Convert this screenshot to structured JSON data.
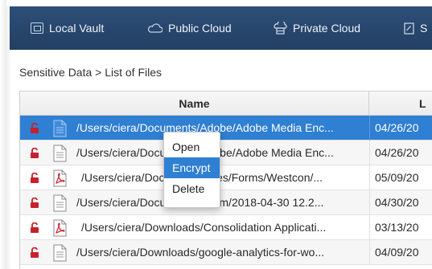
{
  "nav": {
    "items": [
      {
        "label": "Local Vault",
        "icon": "vault-icon"
      },
      {
        "label": "Public Cloud",
        "icon": "cloud-icon"
      },
      {
        "label": "Private Cloud",
        "icon": "private-cloud-icon"
      },
      {
        "label": "S",
        "icon": "document-icon"
      }
    ],
    "background_color": "#2a4a70"
  },
  "breadcrumb": "Sensitive Data > List of Files",
  "table": {
    "columns": [
      "Name",
      "L"
    ],
    "rows": [
      {
        "name": "/Users/ciera/Documents/Adobe/Adobe Media Enc...",
        "date": "04/26/20",
        "type": "document",
        "selected": true
      },
      {
        "name": "/Users/ciera/Documents/Adobe/Adobe Media Enc...",
        "date": "04/26/20",
        "type": "document",
        "selected": false
      },
      {
        "name": "/Users/ciera/Documents/Files/Forms/Westcon/...",
        "date": "05/09/20",
        "type": "pdf",
        "selected": false
      },
      {
        "name": "/Users/ciera/Documents/Zoom/2018-04-30 12.2...",
        "date": "04/30/20",
        "type": "document",
        "selected": false
      },
      {
        "name": "/Users/ciera/Downloads/Consolidation Applicati...",
        "date": "03/13/20",
        "type": "pdf",
        "selected": false
      },
      {
        "name": "/Users/ciera/Downloads/google-analytics-for-wo...",
        "date": "04/09/20",
        "type": "document",
        "selected": false
      }
    ],
    "lock_color": "#c8202c",
    "selection_color": "#2f7fd3"
  },
  "context_menu": {
    "items": [
      {
        "label": "Open",
        "active": false
      },
      {
        "label": "Encrypt",
        "active": true
      },
      {
        "label": "Delete",
        "active": false
      }
    ]
  }
}
